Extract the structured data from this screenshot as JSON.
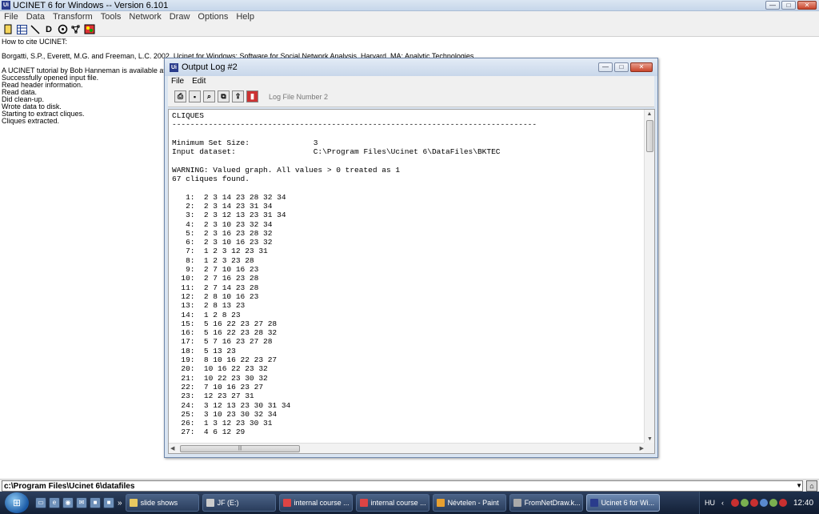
{
  "main_window": {
    "title": "UCINET 6 for Windows -- Version 6.101",
    "menu": [
      "File",
      "Data",
      "Transform",
      "Tools",
      "Network",
      "Draw",
      "Options",
      "Help"
    ],
    "log_lines": [
      "How to cite UCINET:",
      "",
      "Borgatti, S.P., Everett, M.G. and Freeman, L.C. 2002. Ucinet for Windows: Software for Social Network Analysis. Harvard, MA: Analytic Technologies.",
      "",
      "A UCINET tutorial by Bob Hanneman is available at http://faculty.ucr.edu/~hanneman/",
      "Successfully opened input file.",
      "Read header information.",
      "Read data.",
      "Did clean-up.",
      "Wrote data to disk.",
      "Starting to extract cliques.",
      "Cliques extracted."
    ],
    "path_value": "c:\\Program Files\\Ucinet 6\\datafiles"
  },
  "output_window": {
    "title": "Output Log #2",
    "menu": [
      "File",
      "Edit"
    ],
    "log_label": "Log File Number 2",
    "content_lines": [
      "CLIQUES",
      "--------------------------------------------------------------------------------",
      "",
      "Minimum Set Size:              3",
      "Input dataset:                 C:\\Program Files\\Ucinet 6\\DataFiles\\BKTEC",
      "",
      "WARNING: Valued graph. All values > 0 treated as 1",
      "67 cliques found.",
      "",
      "   1:  2 3 14 23 28 32 34",
      "   2:  2 3 14 23 31 34",
      "   3:  2 3 12 13 23 31 34",
      "   4:  2 3 10 23 32 34",
      "   5:  2 3 16 23 28 32",
      "   6:  2 3 10 16 23 32",
      "   7:  1 2 3 12 23 31",
      "   8:  1 2 3 23 28",
      "   9:  2 7 10 16 23",
      "  10:  2 7 16 23 28",
      "  11:  2 7 14 23 28",
      "  12:  2 8 10 16 23",
      "  13:  2 8 13 23",
      "  14:  1 2 8 23",
      "  15:  5 16 22 23 27 28",
      "  16:  5 16 22 23 28 32",
      "  17:  5 7 16 23 27 28",
      "  18:  5 13 23",
      "  19:  8 10 16 22 23 27",
      "  20:  10 16 22 23 32",
      "  21:  10 22 23 30 32",
      "  22:  7 10 16 23 27",
      "  23:  12 23 27 31",
      "  24:  3 12 13 23 30 31 34",
      "  25:  3 10 23 30 32 34",
      "  26:  1 3 12 23 30 31",
      "  27:  4 6 12 29"
    ]
  },
  "taskbar": {
    "buttons": [
      {
        "label": "slide shows",
        "active": false
      },
      {
        "label": "JF (E:)",
        "active": false
      },
      {
        "label": "internal course ...",
        "active": false
      },
      {
        "label": "internal course ...",
        "active": false
      },
      {
        "label": "Névtelen - Paint",
        "active": false
      },
      {
        "label": "FromNetDraw.k...",
        "active": false
      },
      {
        "label": "Ucinet 6 for Wi...",
        "active": true
      }
    ],
    "language": "HU",
    "clock": "12:40"
  }
}
